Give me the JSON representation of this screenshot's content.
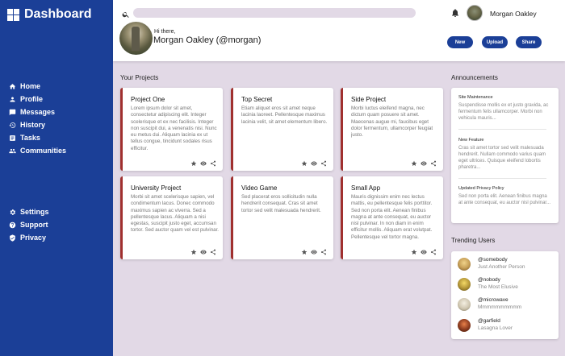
{
  "brand": {
    "title": "Dashboard"
  },
  "nav_top": [
    {
      "label": "Home",
      "icon": "home-icon"
    },
    {
      "label": "Profile",
      "icon": "person-icon"
    },
    {
      "label": "Messages",
      "icon": "chat-icon"
    },
    {
      "label": "History",
      "icon": "history-icon"
    },
    {
      "label": "Tasks",
      "icon": "tasks-icon"
    },
    {
      "label": "Communities",
      "icon": "group-icon"
    }
  ],
  "nav_bottom": [
    {
      "label": "Settings",
      "icon": "gear-icon"
    },
    {
      "label": "Support",
      "icon": "help-icon"
    },
    {
      "label": "Privacy",
      "icon": "shield-icon"
    }
  ],
  "header": {
    "search_placeholder": "",
    "user_name": "Morgan Oakley",
    "greeting": "Hi there,",
    "greeting_name": "Morgan Oakley (@morgan)",
    "buttons": {
      "new": "New",
      "upload": "Upload",
      "share": "Share"
    }
  },
  "sections": {
    "projects": "Your Projects",
    "announcements": "Announcements",
    "trending": "Trending Users"
  },
  "projects": [
    {
      "title": "Project One",
      "body": "Lorem ipsum dolor sit amet, consectetur adipiscing elit. Integer scelerisque et ex nec facilisis. Integer non suscipit dui, a venenatis nisi. Nunc eu metus dui. Aliquam lacinia ex ut tellus congue, tincidunt sodales risus efficitur."
    },
    {
      "title": "Top Secret",
      "body": "Etiam aliquet eros sit amet neque lacinia laoreet. Pellentesque maximus lacinia velit, sit amet elementum libero."
    },
    {
      "title": "Side Project",
      "body": "Morbi luctus eleifend magna, nec dictum quam posuere sit amet. Maecenas augue mi, faucibus eget dolor fermentum, ullamcorper feugiat justo."
    },
    {
      "title": "University Project",
      "body": "Morbi sit amet scelerisque sapien, vel condimentum lacus. Donec commodo maximus sapien ac viverra. Sed a pellentesque lacus. Aliquam a nisi egestas, suscipit justo eget, accumsan tortor. Sed auctor quam vel est pulvinar."
    },
    {
      "title": "Video Game",
      "body": "Sed placerat eros sollicitudin nulla hendrerit consequat. Cras sit amet tortor sed velit malesuada hendrerit."
    },
    {
      "title": "Small App",
      "body": "Mauris dignissim enim nec lectus mattis, eu pellentesque felis porttitor. Sed non porta elit. Aenean finibus magna at ante consequat, eu auctor nisl pulvinar. In non diam in enim efficitur mollis. Aliquam erat volutpat. Pellentesque vel tortor magna."
    }
  ],
  "announcements": [
    {
      "title": "Site Maintenance",
      "text": "Suspendisse mollis ex et justo gravida, ac fermentum felis ullamcorper. Morbi non vehicula mauris..."
    },
    {
      "title": "New Feature",
      "text": "Cras sit amet tortor sed velit malesuada hendrerit. Nullam commodo varius quam eget ultrices. Quisque eleifend lobortis pharetra..."
    },
    {
      "title": "Updated Privacy Policy",
      "text": "Sed non porta elit. Aenean finibus magna at ante consequat, eu auctor nisl pulvinar..."
    }
  ],
  "trending": [
    {
      "handle": "@somebody",
      "sub": "Just Another Person",
      "color": "#c9a25a"
    },
    {
      "handle": "@nobody",
      "sub": "The Most Elusive",
      "color": "#b89a3a"
    },
    {
      "handle": "@microwave",
      "sub": "Mmmmmmmmmm",
      "color": "#cfc6b0"
    },
    {
      "handle": "@garfield",
      "sub": "Lasagna Lover",
      "color": "#8a3a1e"
    }
  ],
  "colors": {
    "sidebar": "#1b3f97",
    "accent": "#a0302f",
    "background": "#e2d9e6"
  }
}
